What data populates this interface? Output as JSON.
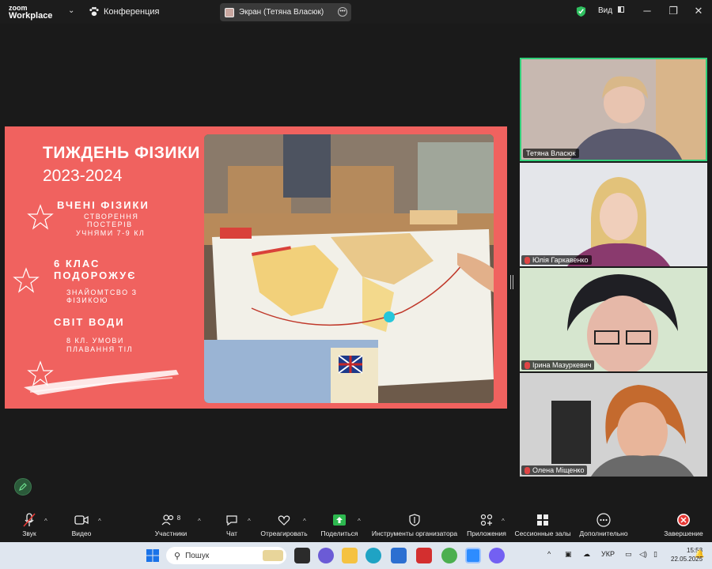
{
  "titlebar": {
    "logo_top": "zoom",
    "logo_bottom": "Workplace",
    "meeting_label": "Конференция",
    "screen_share_label": "Экран (Тетяна Власюк)",
    "view_label": "Вид",
    "shield_color": "#2fbf5f"
  },
  "slide": {
    "title_line1": "ТИЖДЕНЬ ФІЗИКИ",
    "title_line2": "2023-2024",
    "sections": [
      {
        "heading": "ВЧЕНІ ФІЗИКИ",
        "sub1": "СТВОРЕННЯ",
        "sub2": "ПОСТЕРІВ",
        "sub3": "УЧНЯМИ 7-9 КЛ"
      },
      {
        "heading1": "6 КЛАС",
        "heading2": "ПОДОРОЖУЄ",
        "sub1": "ЗНАЙОМТСВО З",
        "sub2": "ФІЗИКОЮ"
      },
      {
        "heading": "СВІТ ВОДИ",
        "sub1": "8 КЛ. УМОВИ",
        "sub2": "ПЛАВАННЯ ТІЛ"
      }
    ],
    "background_color": "#f0625f"
  },
  "participants": [
    {
      "name": "Тетяна Власюк",
      "muted": false,
      "active": true
    },
    {
      "name": "Юлія Гаркавенко",
      "muted": true,
      "active": false
    },
    {
      "name": "Ірина Мазуркевич",
      "muted": true,
      "active": false
    },
    {
      "name": "Олена Міщенко",
      "muted": true,
      "active": false
    }
  ],
  "toolbar": {
    "audio": "Звук",
    "video": "Видео",
    "participants": "Участники",
    "participants_count": "8",
    "chat": "Чат",
    "react": "Отреагировать",
    "share": "Поделиться",
    "host_tools": "Инструменты организатора",
    "apps": "Приложения",
    "breakout": "Сессионные залы",
    "more": "Дополнительно",
    "end": "Завершение"
  },
  "taskbar": {
    "search_placeholder": "Пошук",
    "language": "УКР",
    "time": "15:53",
    "date": "22.05.2025"
  }
}
